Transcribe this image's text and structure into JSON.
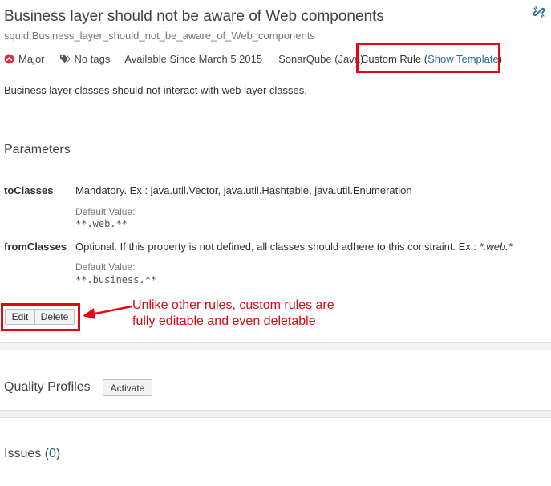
{
  "rule": {
    "title": "Business layer should not be aware of Web components",
    "key": "squid:Business_layer_should_not_be_aware_of_Web_components",
    "severity": "Major",
    "tags": "No tags",
    "available_since": "Available Since March 5 2015",
    "repository": "SonarQube (Java)",
    "custom_rule_label": "Custom Rule (",
    "show_template_link": "Show Template",
    "custom_rule_close": ")",
    "description": "Business layer classes should not interact with web layer classes."
  },
  "parameters": {
    "section_title": "Parameters",
    "default_value_label": "Default Value:",
    "items": [
      {
        "name": "toClasses",
        "description": "Mandatory. Ex : java.util.Vector, java.util.Hashtable, java.util.Enumeration",
        "default_value": "**.web.**"
      },
      {
        "name": "fromClasses",
        "description_prefix": "Optional. If this property is not defined, all classes should adhere to this constraint. Ex : ",
        "description_emphasis": "*.web.*",
        "default_value": "**.business.**"
      }
    ]
  },
  "actions": {
    "edit_label": "Edit",
    "delete_label": "Delete"
  },
  "annotation": {
    "line1": "Unlike other rules, custom rules are",
    "line2": "fully editable and even deletable"
  },
  "quality_profiles": {
    "title": "Quality Profiles",
    "activate_label": "Activate"
  },
  "issues": {
    "title_prefix": "Issues (",
    "count": "0",
    "title_suffix": ")"
  },
  "colors": {
    "link": "#236a97",
    "annotation_red": "#e30613",
    "severity_major": "#d4333f"
  },
  "icons": {
    "permalink": "link-icon",
    "severity": "severity-major-icon",
    "tags": "tags-icon"
  }
}
